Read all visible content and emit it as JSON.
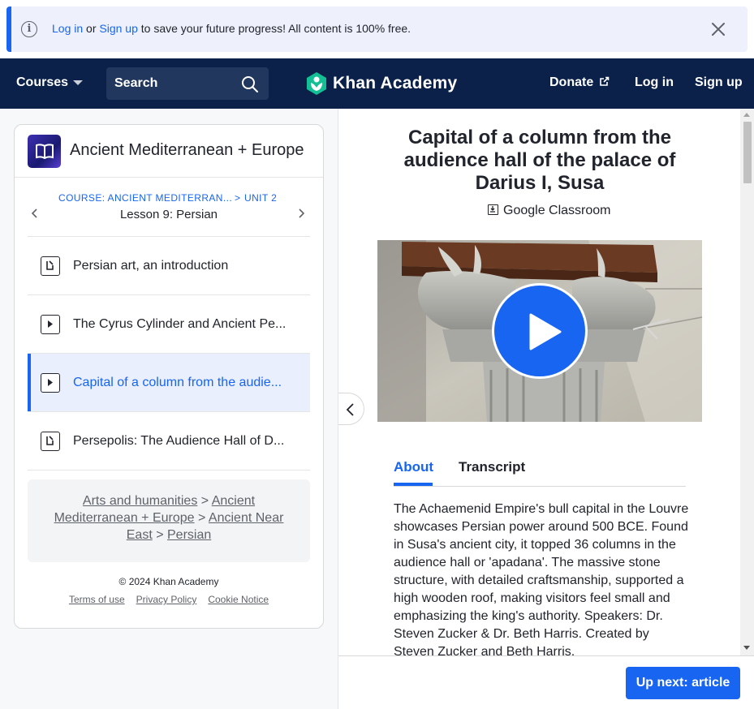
{
  "banner": {
    "login_link": "Log in",
    "or_text": " or ",
    "signup_link": "Sign up",
    "message": " to save your future progress! All content is 100% free."
  },
  "header": {
    "courses": "Courses",
    "search_label": "Search",
    "logo_text": "Khan Academy",
    "donate": "Donate",
    "login": "Log in",
    "signup": "Sign up"
  },
  "sidebar": {
    "course_title": "Ancient Mediterranean + Europe",
    "breadcrumb_course": "COURSE: ANCIENT MEDITERRAN...",
    "breadcrumb_sep": ">",
    "breadcrumb_unit": "UNIT 2",
    "lesson_title": "Lesson 9: Persian",
    "items": [
      {
        "label": "Persian art, an introduction",
        "type": "article",
        "active": false
      },
      {
        "label": "The Cyrus Cylinder and Ancient Pe...",
        "type": "video",
        "active": false
      },
      {
        "label": "Capital of a column from the audie...",
        "type": "video",
        "active": true
      },
      {
        "label": "Persepolis: The Audience Hall of D...",
        "type": "article",
        "active": false
      }
    ],
    "path": {
      "arts": "Arts and humanities",
      "sep": " > ",
      "ancient": "Ancient Mediterranean + Europe",
      "near_east": "Ancient Near East",
      "persian": "Persian"
    },
    "copyright": "© 2024 Khan Academy",
    "footer_links": {
      "terms": "Terms of use",
      "privacy": "Privacy Policy",
      "cookie": "Cookie Notice"
    }
  },
  "main": {
    "title": "Capital of a column from the audience hall of the palace of Darius I, Susa",
    "classroom": "Google Classroom",
    "tabs": [
      {
        "label": "About",
        "active": true
      },
      {
        "label": "Transcript",
        "active": false
      }
    ],
    "description": "The Achaemenid Empire's bull capital in the Louvre showcases Persian power around 500 BCE. Found in Susa's ancient city, it topped 36 columns in the audience hall or 'apadana'. The massive stone structure, with detailed craftsmanship, supported a high wooden roof, making visitors feel small and emphasizing the king's authority. Speakers: Dr. Steven Zucker & Dr. Beth Harris. Created by Steven Zucker and Beth Harris.",
    "up_next": "Up next: article"
  },
  "colors": {
    "accent": "#1865f2",
    "navy": "#0b2149",
    "logo_green": "#14bf96"
  }
}
